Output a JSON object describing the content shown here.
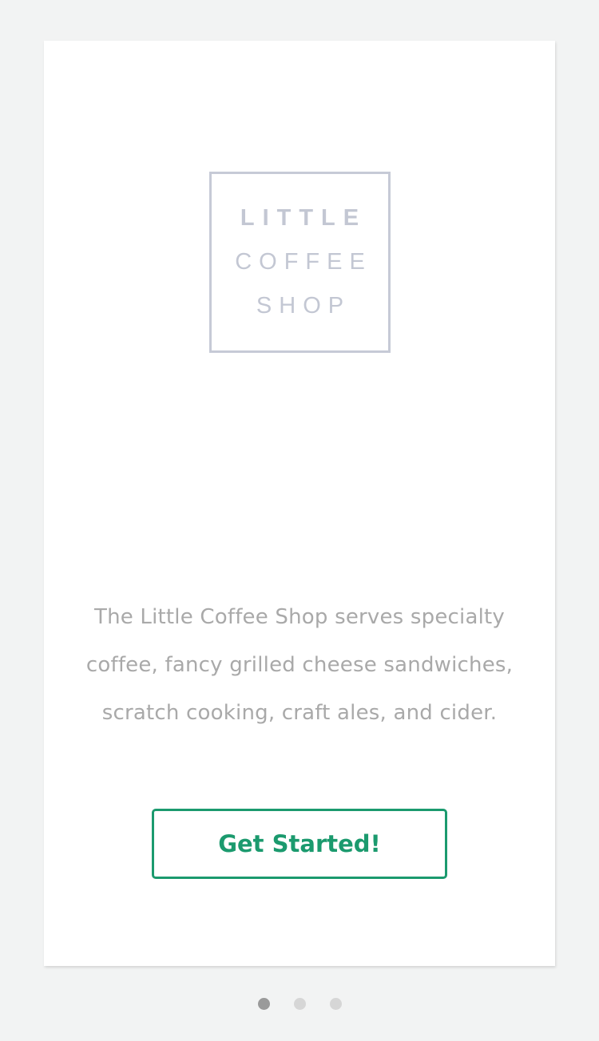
{
  "logo": {
    "line1": "LITTLE",
    "line2": "COFFEE",
    "line3": "SHOP"
  },
  "description": "The Little Coffee Shop serves specialty coffee, fancy grilled cheese sandwiches, scratch cooking, craft ales, and cider.",
  "cta_label": "Get Started!",
  "pager": {
    "total_pages": 3,
    "active_page": 1
  },
  "colors": {
    "accent": "#1b9a6e",
    "logo": "#c6cad6",
    "text_muted": "#a9a9a9",
    "background": "#f2f3f3"
  }
}
